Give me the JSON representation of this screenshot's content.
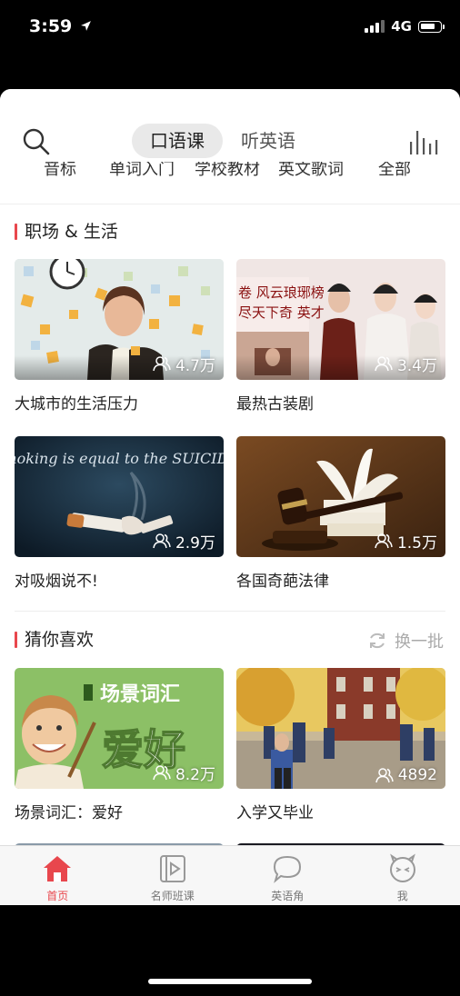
{
  "status": {
    "time": "3:59",
    "network": "4G"
  },
  "header": {
    "tabs": [
      {
        "label": "口语课"
      },
      {
        "label": "听英语"
      }
    ]
  },
  "categories": [
    "音标",
    "单词入门",
    "学校教材",
    "英文歌词",
    "全部"
  ],
  "sections": [
    {
      "title": "职场 & 生活",
      "cards": [
        {
          "title": "大城市的生活压力",
          "count": "4.7万"
        },
        {
          "title": "最热古装剧",
          "count": "3.4万"
        },
        {
          "title": "对吸烟说不!",
          "count": "2.9万",
          "image_text": "Smoking is equal to the SUICIDE!"
        },
        {
          "title": "各国奇葩法律",
          "count": "1.5万"
        }
      ]
    },
    {
      "title": "猜你喜欢",
      "refresh_label": "换一批",
      "cards": [
        {
          "title": "场景词汇：爱好",
          "count": "8.2万",
          "image_text_top": "场景词汇",
          "image_text_big": "爱好"
        },
        {
          "title": "入学又毕业",
          "count": "4892"
        }
      ]
    }
  ],
  "drama_overlay": {
    "line1": "卷 风云琅琊榜",
    "line2": "尽天下奇 英才"
  },
  "tabbar": [
    {
      "label": "首页",
      "icon": "home-icon"
    },
    {
      "label": "名师班课",
      "icon": "video-icon"
    },
    {
      "label": "英语角",
      "icon": "chat-icon"
    },
    {
      "label": "我",
      "icon": "face-icon"
    }
  ],
  "colors": {
    "accent": "#e8474d",
    "active_tab_bg": "#e9e9e9"
  }
}
